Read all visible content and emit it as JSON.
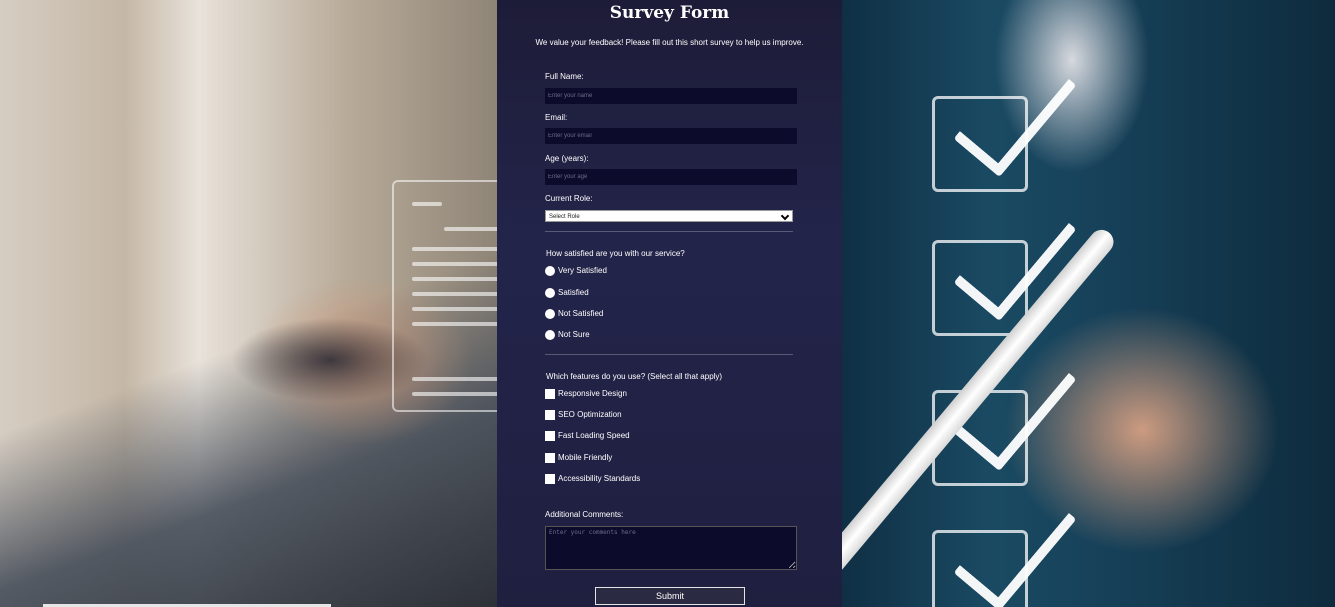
{
  "form": {
    "title": "Survey Form",
    "description": "We value your feedback! Please fill out this short survey to help us improve.",
    "fields": {
      "name_label": "Full Name:",
      "name_placeholder": "Enter your name",
      "email_label": "Email:",
      "email_placeholder": "Enter your email",
      "age_label": "Age (years):",
      "age_placeholder": "Enter your age",
      "role_label": "Current Role:",
      "role_selected": "Select Role"
    },
    "satisfaction": {
      "question": "How satisfied are you with our service?",
      "options": [
        "Very Satisfied",
        "Satisfied",
        "Not Satisfied",
        "Not Sure"
      ]
    },
    "features": {
      "question": "Which features do you use? (Select all that apply)",
      "options": [
        "Responsive Design",
        "SEO Optimization",
        "Fast Loading Speed",
        "Mobile Friendly",
        "Accessibility Standards"
      ]
    },
    "comments": {
      "label": "Additional Comments:",
      "placeholder": "Enter your comments here"
    },
    "submit_label": "Submit"
  },
  "theme": {
    "panel_color": "#1f1f40",
    "input_color": "#0c0b2c"
  },
  "background": {
    "left_icons": [
      "document-icon"
    ],
    "right_icons": [
      "checkbox-checked-icon",
      "checkbox-checked-icon",
      "checkbox-checked-icon",
      "checkbox-checked-icon",
      "pen-icon"
    ]
  }
}
